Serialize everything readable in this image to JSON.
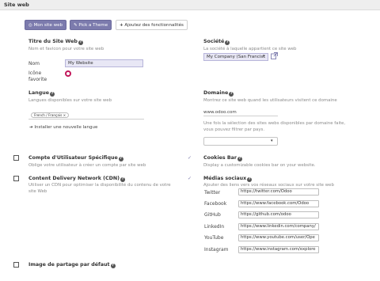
{
  "section": {
    "title": "Site web"
  },
  "buttons": {
    "website": "Mon site web",
    "theme": "Pick a Theme",
    "features": "Ajoutez des fonctionnalités",
    "features_icon": "plus-icon"
  },
  "site_title": {
    "title": "Titre du Site Web",
    "help": "Nom et favicon pour votre site web",
    "name_label": "Nom",
    "name_value": "My Website",
    "favicon_label_1": "Icône",
    "favicon_label_2": "favorite"
  },
  "company": {
    "title": "Société",
    "help": "La société à laquelle appartient ce site web",
    "value": "My Company (San Francisc",
    "external_icon": "external-link-icon"
  },
  "languages": {
    "title": "Langue",
    "help": "Langues disponibles sur votre site web",
    "tag": "French / Français",
    "install_link": "Installer une nouvelle langue"
  },
  "domain": {
    "title": "Domaine",
    "help": "Montrez ce site web quand les utilisateurs visitent ce domaine",
    "value": "www.odoo.com",
    "country_help_1": "Une fois la sélection des sites webs disponibles par domaine faite,",
    "country_help_2": "vous pouvez filtrer par pays."
  },
  "specific_account": {
    "title": "Compte d'Utilisateur Spécifique",
    "help": "Oblige votre utilisateur à créer un compte par site web",
    "checked": false
  },
  "cookies_bar": {
    "title": "Cookies Bar",
    "help": "Display a customizable cookies bar on your website.",
    "checked": true
  },
  "cdn": {
    "title": "Content Delivery Network (CDN)",
    "help_1": "Utiliser un CDN pour optimiser la disponibilité du contenu de votre",
    "help_2": "site Web",
    "checked": false
  },
  "social": {
    "title": "Médias sociaux",
    "help_1": "Ajouter des liens vers vos réseaux sociaux sur votre site web",
    "checked": true,
    "rows": [
      {
        "label": "Twitter",
        "value": "https://twitter.com/Odoo"
      },
      {
        "label": "Facebook",
        "value": "https://www.facebook.com/Odoo"
      },
      {
        "label": "GitHub",
        "value": "https://github.com/odoo"
      },
      {
        "label": "LinkedIn",
        "value": "https://www.linkedin.com/company/"
      },
      {
        "label": "YouTube",
        "value": "https://www.youtube.com/user/Ope"
      },
      {
        "label": "Instagram",
        "value": "https://www.instagram.com/explore"
      }
    ]
  },
  "share_image": {
    "title": "Image de partage par défaut",
    "checked": false
  },
  "colors": {
    "accent": "#7c7bad",
    "favicon_ring": "#c2185b"
  }
}
